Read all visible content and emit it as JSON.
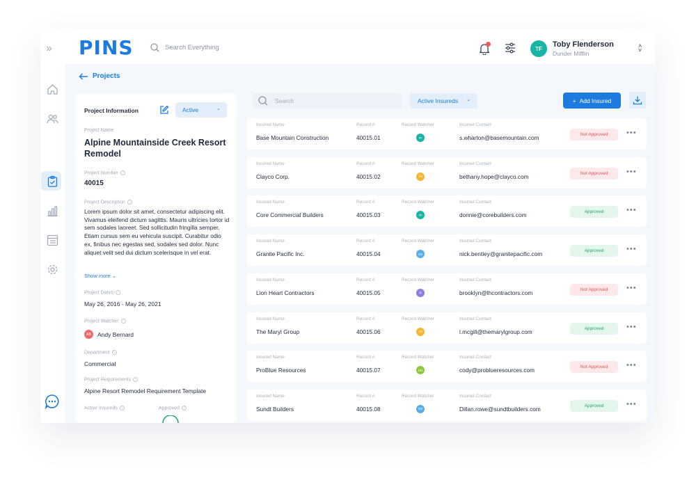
{
  "brand": {
    "logo": "PINS",
    "accent": "#1d7be0"
  },
  "topbar": {
    "search_placeholder": "Search Everything",
    "user": {
      "initials": "TF",
      "name": "Toby Flenderson",
      "org": "Dunder Mifflin"
    },
    "icons": [
      "expand-icon",
      "search-icon",
      "bell-icon",
      "filters-icon",
      "chevron-updown-icon"
    ]
  },
  "sidebar": {
    "items": [
      "home-icon",
      "users-icon",
      "clipboard-icon",
      "chart-icon",
      "list-icon",
      "settings-icon"
    ],
    "active": "clipboard-icon",
    "bottom": "chat-icon"
  },
  "breadcrumb": {
    "back_label": "Projects"
  },
  "project": {
    "section_title": "Project Information",
    "status": "Active",
    "name_label": "Project Name",
    "name": "Alpine Mountainside Creek Resort Remodel",
    "number_label": "Project Number",
    "number": "40015",
    "description_label": "Project Description",
    "description": "Lorem ipsum dolor sit amet, consectetur adipiscing elit. Vivamus eleifend dictum sagittis. Mauris ultricies tortor id sem sodales laoreet. Sed sollicitudin fringilla semper. Etiam cursus sem eu vehicula suscipit. Curabitur odio ex, finibus nec egestas sed, sodales sed dolor. Nunc aliquet velit sed dui dictum scelerisque in vel erat.",
    "show_more": "Show more",
    "dates_label": "Project Dates",
    "dates": "May 26, 2016 - May 26, 2021",
    "watcher_label": "Project Watcher",
    "watcher_initials": "AB",
    "watcher_name": "Andy Bernard",
    "department_label": "Department",
    "department": "Commercial",
    "requirements_label": "Project Requirements",
    "requirements": "Alpine Resort Remodel Requirement Template",
    "active_insureds_label": "Active Insureds",
    "approved_label": "Approved"
  },
  "insureds": {
    "search_placeholder": "Search",
    "filter": "Active Insureds",
    "add_button": "Add Insured",
    "columns": {
      "name": "Insured Name",
      "record": "Record #",
      "watcher": "Record Watcher",
      "contact": "Insured Contact"
    },
    "status_colors": {
      "Not Approved": "#e35555",
      "Approved": "#27a866"
    },
    "rows": [
      {
        "name": "Base Mountain Construction",
        "record": "40015.01",
        "watcher": "TF",
        "watcher_color": "#18b5a6",
        "contact": "s.wharton@basemountain.com",
        "status": "Not Approved"
      },
      {
        "name": "Clayco Corp.",
        "record": "40015.02",
        "watcher": "JH",
        "watcher_color": "#f5b731",
        "contact": "bethany.hope@clayco.com",
        "status": "Not Approved"
      },
      {
        "name": "Core Commercial Builders",
        "record": "40015.03",
        "watcher": "TF",
        "watcher_color": "#18b5a6",
        "contact": "donnie@corebuilders.com",
        "status": "Approved"
      },
      {
        "name": "Granite Pacific Inc.",
        "record": "40015.04",
        "watcher": "DS",
        "watcher_color": "#5aaee8",
        "contact": "nick.bentley@granitepacific.com",
        "status": "Approved"
      },
      {
        "name": "Lion Heart Contractors",
        "record": "40015.05",
        "watcher": "JL",
        "watcher_color": "#8e7ee0",
        "contact": "brooklyn@lhcontractors.com",
        "status": "Not Approved"
      },
      {
        "name": "The Maryl Group",
        "record": "40015.06",
        "watcher": "JH",
        "watcher_color": "#f5b731",
        "contact": "l.mcgill@themarylgroup.com",
        "status": "Approved"
      },
      {
        "name": "ProBlue Resources",
        "record": "40015.07",
        "watcher": "DH",
        "watcher_color": "#8fc83c",
        "contact": "cody@problueresources.com",
        "status": "Not Approved"
      },
      {
        "name": "Sundt Builders",
        "record": "40015.08",
        "watcher": "DS",
        "watcher_color": "#5aaee8",
        "contact": "Dillan.rowe@sundtbuilders.com",
        "status": "Approved"
      }
    ]
  }
}
